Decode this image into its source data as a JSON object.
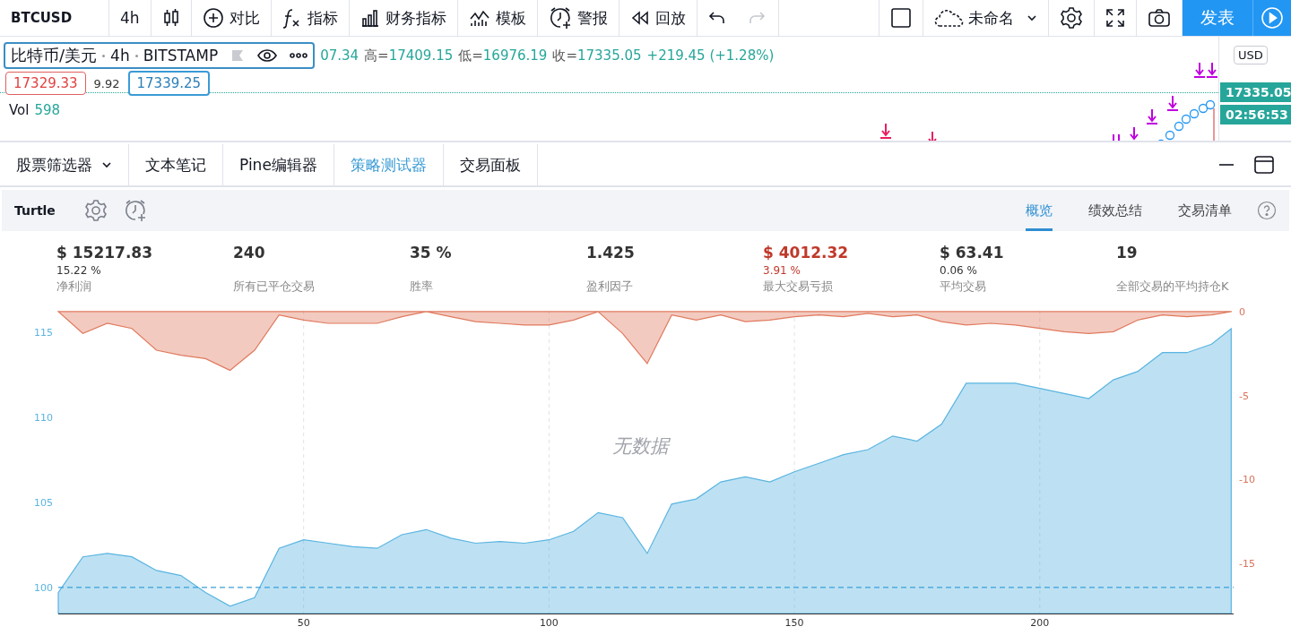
{
  "toolbar": {
    "symbol": "BTCUSD",
    "interval": "4h",
    "left": [
      {
        "kind": "chart-type"
      },
      {
        "kind": "compare",
        "label": "对比"
      },
      {
        "kind": "indicators",
        "label": "指标"
      },
      {
        "kind": "financials",
        "label": "财务指标"
      },
      {
        "kind": "templates",
        "label": "模板"
      },
      {
        "kind": "alert",
        "label": "警报"
      },
      {
        "kind": "replay",
        "label": "回放"
      },
      {
        "kind": "undo",
        "disabled": false
      },
      {
        "kind": "redo",
        "disabled": true
      }
    ],
    "right": [
      {
        "kind": "layout"
      },
      {
        "kind": "layout-name",
        "label": "未命名"
      },
      {
        "kind": "settings"
      },
      {
        "kind": "fullscreen"
      },
      {
        "kind": "snapshot"
      },
      {
        "kind": "publish",
        "label": "发表"
      },
      {
        "kind": "play"
      }
    ]
  },
  "chart": {
    "legend": {
      "title": "比特币/美元",
      "interval": "4h",
      "exchange": "BITSTAMP",
      "ohlc": [
        {
          "value": "07.34"
        },
        {
          "label": "高=",
          "value": "17409.15"
        },
        {
          "label": "低=",
          "value": "16976.19"
        },
        {
          "label": "收=",
          "value": "17335.05"
        }
      ],
      "change": "+219.45 (+1.28%)"
    },
    "bid": "17329.33",
    "spread": "9.92",
    "ask": "17339.25",
    "volume": {
      "label": "Vol",
      "value": "598"
    },
    "price_scale": {
      "currency": "USD",
      "last_price": "17335.05",
      "countdown": "02:56:53"
    }
  },
  "bottom_tabs": [
    {
      "label": "股票筛选器",
      "dropdown": true,
      "selected": false
    },
    {
      "label": "文本笔记",
      "dropdown": false,
      "selected": false
    },
    {
      "label": "Pine编辑器",
      "dropdown": false,
      "selected": false
    },
    {
      "label": "策略测试器",
      "dropdown": false,
      "selected": true
    },
    {
      "label": "交易面板",
      "dropdown": false,
      "selected": false
    }
  ],
  "strategy": {
    "name": "Turtle",
    "views": [
      {
        "label": "概览",
        "selected": true
      },
      {
        "label": "绩效总结",
        "selected": false
      },
      {
        "label": "交易清单",
        "selected": false
      }
    ],
    "stats": [
      {
        "value": "$ 15217.83",
        "sub": "15.22 %",
        "label": "净利润",
        "negative": false
      },
      {
        "value": "240",
        "label": "所有已平仓交易",
        "negative": false
      },
      {
        "value": "35 %",
        "label": "胜率",
        "negative": false
      },
      {
        "value": "1.425",
        "label": "盈利因子",
        "negative": false
      },
      {
        "value": "$ 4012.32",
        "sub": "3.91 %",
        "label": "最大交易亏损",
        "negative": true
      },
      {
        "value": "$ 63.41",
        "sub": "0.06 %",
        "label": "平均交易",
        "negative": false
      },
      {
        "value": "19",
        "label": "全部交易的平均持仓K",
        "negative": false
      }
    ],
    "overlay_text": "无数据",
    "chart_data": {
      "type": "area",
      "x": [
        0,
        5,
        10,
        15,
        20,
        25,
        30,
        35,
        40,
        45,
        50,
        55,
        60,
        65,
        70,
        75,
        80,
        85,
        90,
        95,
        100,
        105,
        110,
        115,
        120,
        125,
        130,
        135,
        140,
        145,
        150,
        155,
        160,
        165,
        170,
        175,
        180,
        185,
        190,
        195,
        200,
        205,
        210,
        215,
        220,
        225,
        230,
        235,
        239
      ],
      "xlim": [
        0,
        239.5
      ],
      "xticks": [
        50,
        100,
        150,
        200
      ],
      "ylim": [
        98.47,
        116.26
      ],
      "yticks": [
        100,
        105,
        110,
        115
      ],
      "y2lim": [
        -18,
        0.05
      ],
      "y2ticks": [
        0,
        -5,
        -10,
        -15
      ],
      "series": [
        {
          "axis": "y2",
          "color": "#e07a5f",
          "values": [
            0,
            -1.3,
            -0.7,
            -1,
            -2.3,
            -2.6,
            -2.8,
            -3.5,
            -2.3,
            -0.2,
            -0.5,
            -0.7,
            -0.7,
            -0.7,
            -0.3,
            0,
            -0.3,
            -0.6,
            -0.7,
            -0.8,
            -0.8,
            -0.5,
            0,
            -1.3,
            -3.1,
            -0.2,
            -0.5,
            -0.2,
            -0.6,
            -0.5,
            -0.3,
            -0.2,
            -0.3,
            -0.1,
            -0.3,
            -0.2,
            -0.6,
            -0.8,
            -0.7,
            -0.8,
            -1,
            -1.2,
            -1.3,
            -1.2,
            -0.5,
            -0.2,
            -0.3,
            -0.2,
            0
          ]
        },
        {
          "color": "#5ab4e0",
          "values": [
            99.7,
            101.8,
            102,
            101.8,
            101,
            100.7,
            99.7,
            98.9,
            99.4,
            102.3,
            102.8,
            102.6,
            102.4,
            102.3,
            103.1,
            103.4,
            102.9,
            102.6,
            102.7,
            102.6,
            102.8,
            103.3,
            104.4,
            104.1,
            102,
            104.9,
            105.2,
            106.2,
            106.5,
            106.2,
            106.8,
            107.3,
            107.8,
            108.1,
            108.9,
            108.6,
            109.6,
            112,
            112,
            112,
            111.7,
            111.4,
            111.1,
            112.2,
            112.7,
            113.8,
            113.8,
            114.3,
            115.2
          ]
        }
      ],
      "grid": true,
      "ref_lines": [
        {
          "axis": "y",
          "value": 100,
          "color": "#3aa0d8"
        }
      ]
    }
  }
}
